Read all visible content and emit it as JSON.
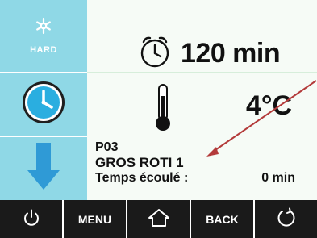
{
  "left_panel": {
    "mode_label": "HARD"
  },
  "main": {
    "duration": "120 min",
    "temperature": "4°C",
    "program_code": "P03",
    "program_name": "GROS ROTI 1",
    "elapsed_label": "Temps écoulé :",
    "elapsed_value": "0 min"
  },
  "bottom_bar": {
    "menu_label": "MENU",
    "back_label": "BACK"
  },
  "colors": {
    "tile": "#8fd8e6",
    "accent_blue": "#2aaee0",
    "arrow_blue": "#2f9ad6",
    "bar": "#1a1a1a",
    "annotation_arrow": "#b33a3a"
  },
  "icons": {
    "mode": "snowflake-icon",
    "clock": "clock-icon",
    "down": "arrow-down-icon",
    "timer": "timer-icon",
    "thermometer": "thermometer-icon",
    "power": "power-icon",
    "home": "home-icon",
    "refresh": "refresh-icon"
  }
}
